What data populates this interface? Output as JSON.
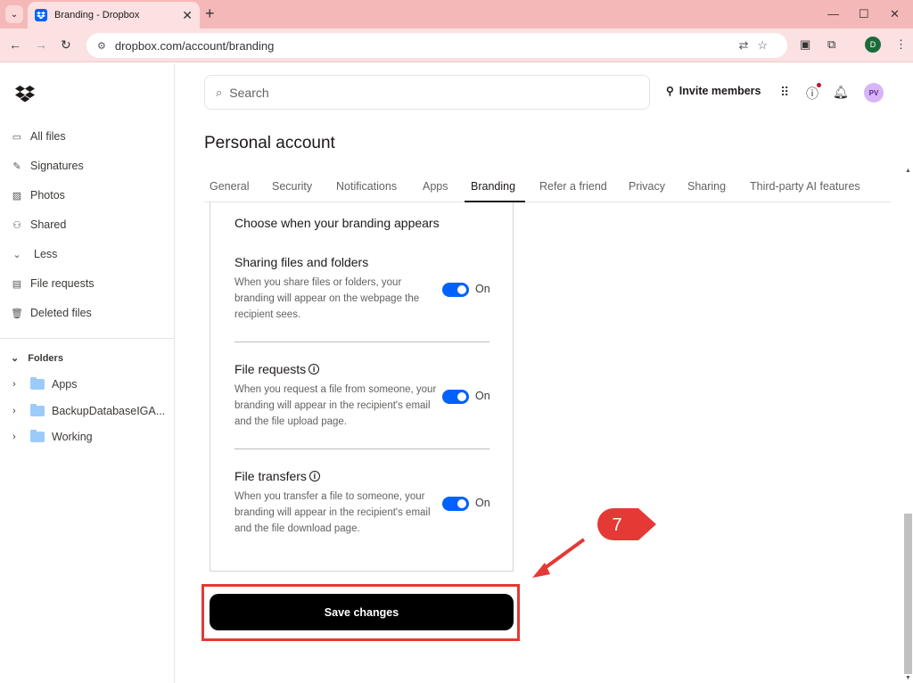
{
  "browser": {
    "tab_title": "Branding - Dropbox",
    "url": "dropbox.com/account/branding",
    "profile_initial": "D"
  },
  "sidebar": {
    "items": [
      {
        "label": "All files",
        "icon": "files-icon"
      },
      {
        "label": "Signatures",
        "icon": "signature-icon"
      },
      {
        "label": "Photos",
        "icon": "photos-icon"
      },
      {
        "label": "Shared",
        "icon": "shared-icon"
      },
      {
        "label": "Less",
        "icon": "chevron-down-icon"
      },
      {
        "label": "File requests",
        "icon": "file-request-icon"
      },
      {
        "label": "Deleted files",
        "icon": "trash-icon"
      }
    ],
    "folders_header": "Folders",
    "folders": [
      "Apps",
      "BackupDatabaseIGA...",
      "Working"
    ]
  },
  "header": {
    "search_placeholder": "Search",
    "invite_label": "Invite members",
    "avatar_initials": "PV"
  },
  "page": {
    "title": "Personal account",
    "tabs": [
      "General",
      "Security",
      "Notifications",
      "Apps",
      "Branding",
      "Refer a friend",
      "Privacy",
      "Sharing",
      "Third-party AI features"
    ],
    "active_tab": "Branding"
  },
  "branding": {
    "heading": "Choose when your branding appears",
    "sections": [
      {
        "title": "Sharing files and folders",
        "description": "When you share files or folders, your branding will appear on the webpage the recipient sees.",
        "toggle": "On",
        "has_info": false
      },
      {
        "title": "File requests",
        "description": "When you request a file from someone, your branding will appear in the recipient's email and the file upload page.",
        "toggle": "On",
        "has_info": true
      },
      {
        "title": "File transfers",
        "description": "When you transfer a file to someone, your branding will appear in the recipient's email and the file download page.",
        "toggle": "On",
        "has_info": true
      }
    ],
    "save_label": "Save changes"
  },
  "annotation": {
    "step_number": "7",
    "color": "#e53935"
  }
}
